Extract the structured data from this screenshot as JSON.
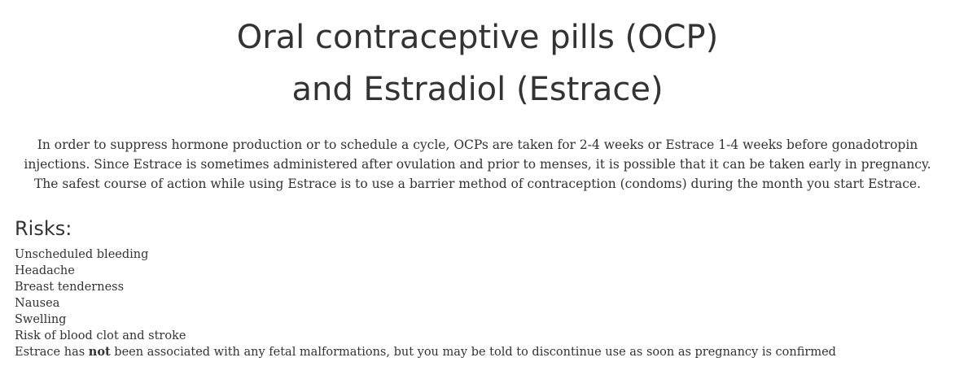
{
  "title": {
    "line1": "Oral contraceptive pills (OCP)",
    "line2": "and Estradiol (Estrace)"
  },
  "intro": {
    "line1": "In order to suppress hormone production or to schedule a cycle, OCPs are taken for 2-4 weeks or Estrace 1-4 weeks before gonadotropin",
    "line2": "injections. Since Estrace is sometimes administered after ovulation and prior to menses, it is possible that it can be taken early in pregnancy.",
    "line3": "The safest course of action while using Estrace is to use a barrier method of contraception (condoms) during the month you start Estrace."
  },
  "risks": {
    "heading": "Risks:",
    "items": [
      "Unscheduled bleeding",
      "Headache",
      "Breast tenderness",
      "Nausea",
      "Swelling",
      "Risk of blood clot and stroke"
    ],
    "last_item": {
      "before": "Estrace has ",
      "emphasis": "not",
      "after": " been associated with any fetal malformations, but you may be told to discontinue use as soon as pregnancy is confirmed"
    }
  }
}
